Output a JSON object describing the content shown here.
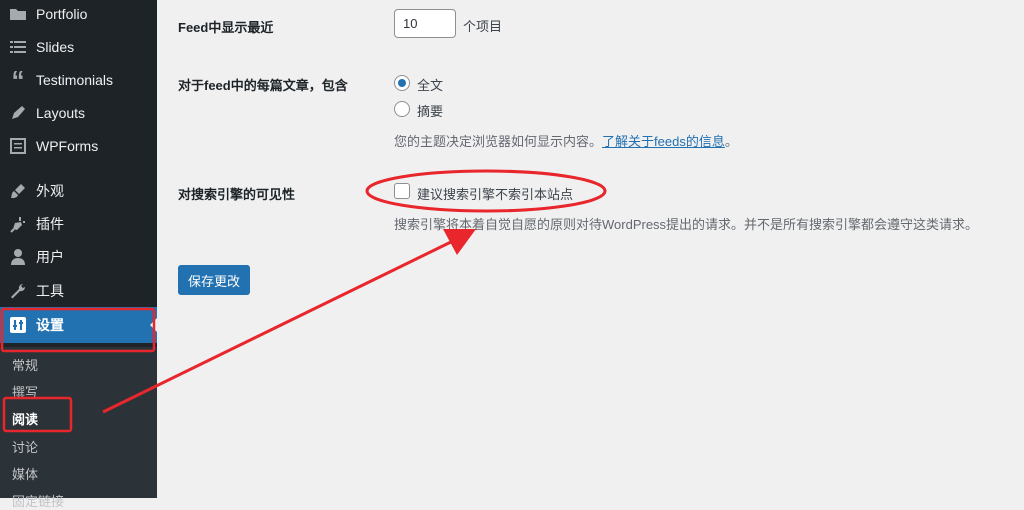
{
  "sidebar": {
    "items": [
      {
        "label": "Portfolio",
        "icon": "folder-icon"
      },
      {
        "label": "Slides",
        "icon": "slides-icon"
      },
      {
        "label": "Testimonials",
        "icon": "quote-icon"
      },
      {
        "label": "Layouts",
        "icon": "pen-icon"
      },
      {
        "label": "WPForms",
        "icon": "form-icon"
      },
      {
        "label": "外观",
        "icon": "brush-icon"
      },
      {
        "label": "插件",
        "icon": "plugin-icon"
      },
      {
        "label": "用户",
        "icon": "user-icon"
      },
      {
        "label": "工具",
        "icon": "wrench-icon"
      },
      {
        "label": "设置",
        "icon": "settings-icon"
      }
    ],
    "submenu": [
      "常规",
      "撰写",
      "阅读",
      "讨论",
      "媒体",
      "固定链接"
    ],
    "current_item": "设置",
    "current_subitem": "阅读"
  },
  "settings": {
    "feed_count": {
      "label": "Feed中显示最近",
      "value": "10",
      "suffix": "个项目"
    },
    "feed_content": {
      "label": "对于feed中的每篇文章，包含",
      "options": [
        "全文",
        "摘要"
      ],
      "selected": "全文",
      "description": "您的主题决定浏览器如何显示内容。",
      "link_text": "了解关于feeds的信息",
      "link_suffix": "。"
    },
    "visibility": {
      "label": "对搜索引擎的可见性",
      "checkbox_label": "建议搜索引擎不索引本站点",
      "checked": false,
      "description": "搜索引擎将本着自觉自愿的原则对待WordPress提出的请求。并不是所有搜索引擎都会遵守这类请求。"
    },
    "save_label": "保存更改"
  },
  "colors": {
    "accent": "#2271b1",
    "annotation": "#e8262b",
    "sidebar_bg": "#1d2327"
  }
}
